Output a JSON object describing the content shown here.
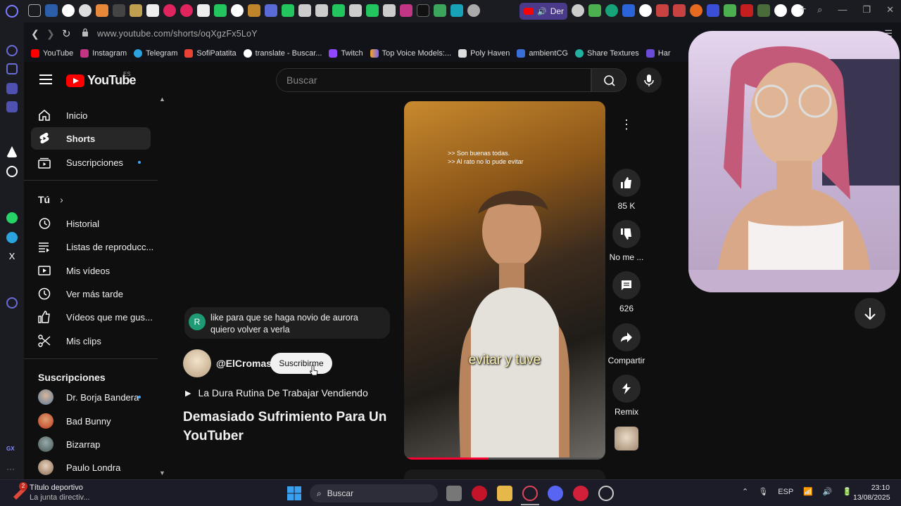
{
  "browser": {
    "url": "www.youtube.com/shorts/oqXgzFx5LoY",
    "active_tab_label": "Der",
    "bookmarks": [
      "YouTube",
      "Instagram",
      "Telegram",
      "SofiPatatita",
      "translate - Buscar...",
      "Twitch",
      "Top Voice Models:...",
      "Poly Haven",
      "ambientCG",
      "Share Textures",
      "Har"
    ]
  },
  "header": {
    "logo_text": "YouTube",
    "region": "ES",
    "search_placeholder": "Buscar"
  },
  "sidebar": {
    "primary": [
      {
        "label": "Inicio",
        "icon": "home-icon"
      },
      {
        "label": "Shorts",
        "icon": "shorts-icon",
        "active": true
      },
      {
        "label": "Suscripciones",
        "icon": "subscriptions-icon",
        "new": true
      }
    ],
    "you_heading": "Tú",
    "you_items": [
      {
        "label": "Historial",
        "icon": "history-icon"
      },
      {
        "label": "Listas de reproducc...",
        "icon": "playlist-icon"
      },
      {
        "label": "Mis vídeos",
        "icon": "my-videos-icon"
      },
      {
        "label": "Ver más tarde",
        "icon": "watch-later-icon"
      },
      {
        "label": "Vídeos que me gus...",
        "icon": "liked-icon"
      },
      {
        "label": "Mis clips",
        "icon": "clips-icon"
      }
    ],
    "subs_heading": "Suscripciones",
    "subs": [
      {
        "label": "Dr. Borja Bandera",
        "new": true
      },
      {
        "label": "Bad Bunny"
      },
      {
        "label": "Bizarrap"
      },
      {
        "label": "Paulo Londra"
      }
    ]
  },
  "short": {
    "caption_lines": [
      ">> Son buenas todas.",
      ">> Al rato no lo pude evitar"
    ],
    "caption_main": "evitar y tuve",
    "progress": 0.42,
    "comment_initial": "R",
    "comment_text": "like para que se haga novio de aurora quiero volver a verla",
    "channel": "@ElCromas",
    "subscribe_label": "Suscribirme",
    "playlist": "La Dura Rutina De Trabajar Vendiendo",
    "title": "Demasiado Sufrimiento Para Un YouTuber"
  },
  "actions": {
    "likes": "85 K",
    "dislike": "No me ...",
    "comments": "626",
    "share": "Compartir",
    "remix": "Remix"
  },
  "taskbar": {
    "news_badge": "2",
    "news_title": "Título deportivo",
    "news_sub": "La junta directiv...",
    "search": "Buscar",
    "lang": "ESP",
    "time": "23:10",
    "date": "13/08/2025"
  },
  "colors": {
    "accent": "#ff0000",
    "link": "#3ea6ff",
    "opera": "#7b7dff"
  }
}
